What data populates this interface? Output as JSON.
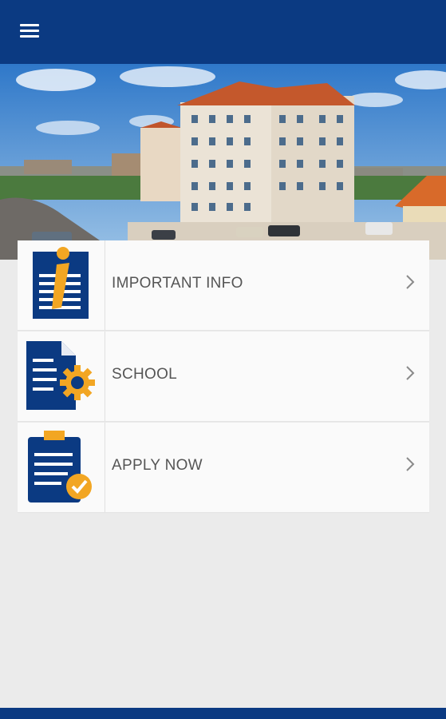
{
  "appbar": {
    "menu_icon": "hamburger-menu-icon",
    "color": "#0b3a82"
  },
  "hero": {
    "image": "campus-building-photo"
  },
  "menu": {
    "items": [
      {
        "label": "IMPORTANT INFO",
        "icon": "info-document-icon"
      },
      {
        "label": "SCHOOL",
        "icon": "document-gear-icon"
      },
      {
        "label": "APPLY NOW",
        "icon": "clipboard-check-icon"
      }
    ]
  },
  "colors": {
    "primary": "#0b3a82",
    "accent": "#f2a623",
    "background": "#ebebeb"
  }
}
